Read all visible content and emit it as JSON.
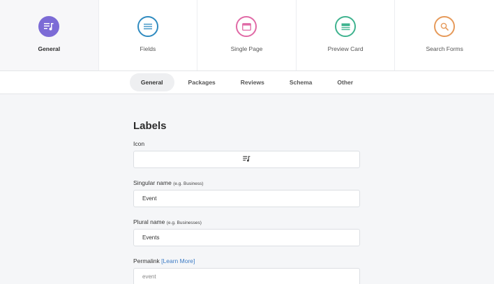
{
  "top_tabs": [
    {
      "label": "General",
      "icon": "playlist-icon",
      "color": "#7c6bd6"
    },
    {
      "label": "Fields",
      "icon": "list-icon",
      "color": "#2f8bc0"
    },
    {
      "label": "Single Page",
      "icon": "window-icon",
      "color": "#e06aa6"
    },
    {
      "label": "Preview Card",
      "icon": "card-icon",
      "color": "#3fb38f"
    },
    {
      "label": "Search Forms",
      "icon": "search-icon",
      "color": "#e69a5a"
    }
  ],
  "sub_tabs": [
    "General",
    "Packages",
    "Reviews",
    "Schema",
    "Other"
  ],
  "form": {
    "section_title": "Labels",
    "icon_label": "Icon",
    "singular_label": "Singular name",
    "singular_hint": "(e.g. Business)",
    "singular_value": "Event",
    "plural_label": "Plural name",
    "plural_hint": "(e.g. Businesses)",
    "plural_value": "Events",
    "permalink_label": "Permalink",
    "permalink_link": "[Learn More]",
    "permalink_placeholder": "event"
  }
}
